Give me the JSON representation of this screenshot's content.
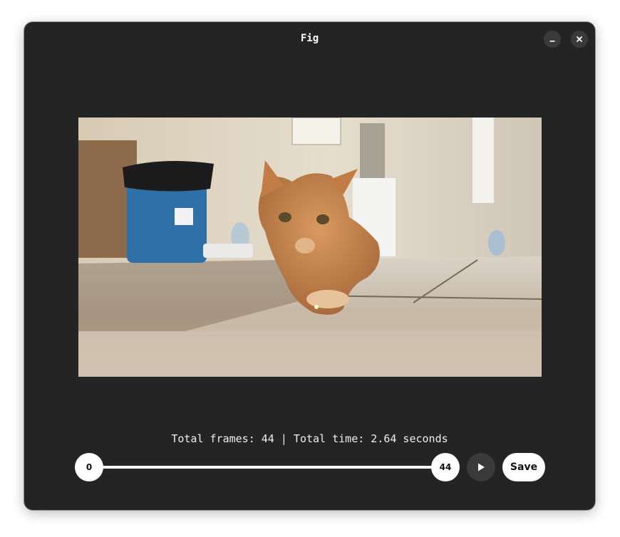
{
  "window": {
    "title": "Fig"
  },
  "controls": {
    "minimize_icon": "minimize-icon",
    "close_icon": "close-icon"
  },
  "info": {
    "text": "Total frames: 44 | Total time: 2.64 seconds"
  },
  "range": {
    "start_label": "0",
    "end_label": "44",
    "start_value": 0,
    "end_value": 44,
    "min": 0,
    "max": 44
  },
  "player": {
    "play_icon": "play-icon",
    "save_label": "Save"
  },
  "colors": {
    "window_bg": "#242424",
    "button_dark": "#3a3a3a",
    "accent_light": "#ffffff"
  }
}
